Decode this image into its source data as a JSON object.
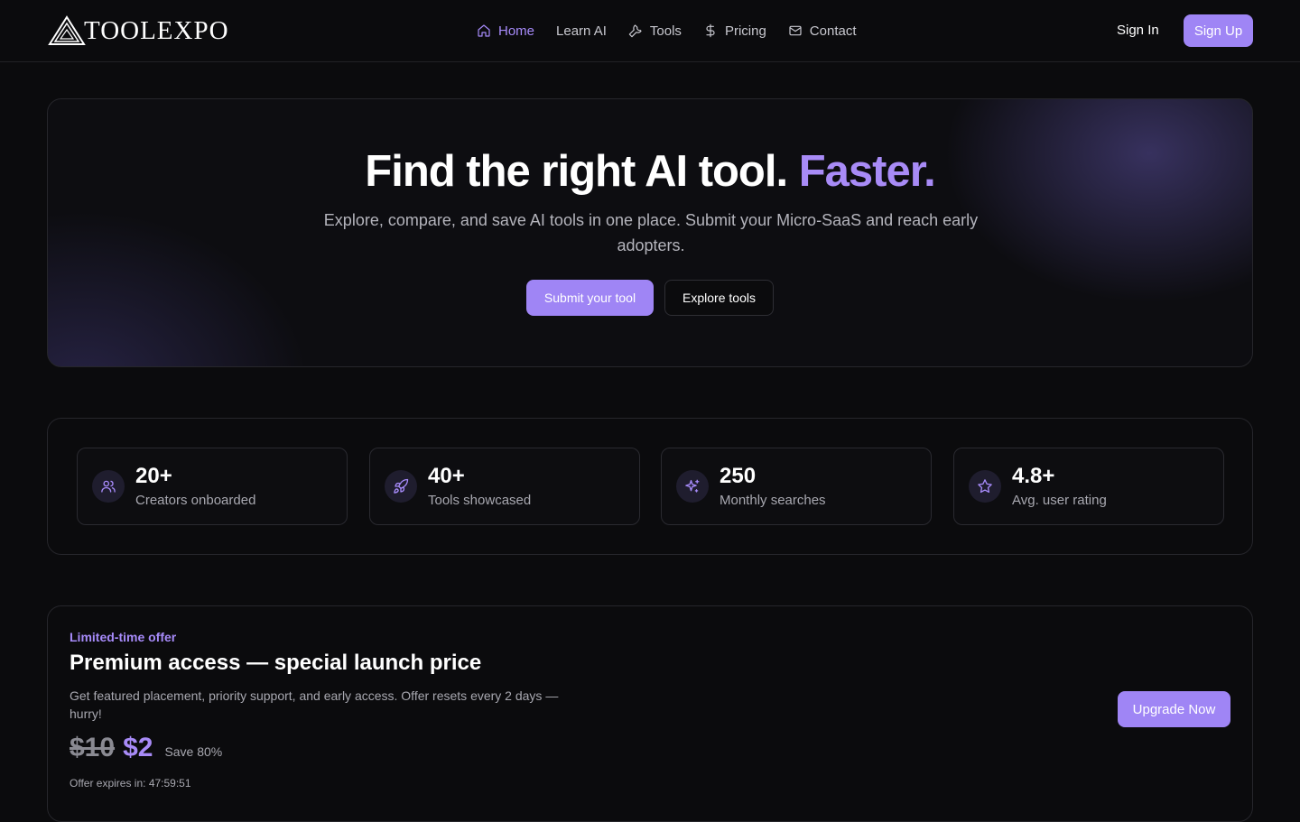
{
  "brand": {
    "name": "TOOLEXPO"
  },
  "nav": {
    "items": [
      {
        "label": "Home",
        "icon": "home-icon",
        "active": true
      },
      {
        "label": "Learn AI",
        "icon": "",
        "active": false
      },
      {
        "label": "Tools",
        "icon": "wrench-icon",
        "active": false
      },
      {
        "label": "Pricing",
        "icon": "dollar-icon",
        "active": false
      },
      {
        "label": "Contact",
        "icon": "mail-icon",
        "active": false
      }
    ],
    "sign_in": "Sign In",
    "sign_up": "Sign Up"
  },
  "hero": {
    "title_main": "Find the right AI tool.",
    "title_accent": "Faster.",
    "subtitle": "Explore, compare, and save AI tools in one place. Submit your Micro-SaaS and reach early adopters.",
    "primary_button": "Submit your tool",
    "secondary_button": "Explore tools"
  },
  "stats": [
    {
      "value": "20+",
      "label": "Creators onboarded",
      "icon": "users-icon"
    },
    {
      "value": "40+",
      "label": "Tools showcased",
      "icon": "rocket-icon"
    },
    {
      "value": "250",
      "label": "Monthly searches",
      "icon": "sparkles-icon"
    },
    {
      "value": "4.8+",
      "label": "Avg. user rating",
      "icon": "star-icon"
    }
  ],
  "offer": {
    "tag": "Limited-time offer",
    "title": "Premium access — special launch price",
    "description": "Get featured placement, priority support, and early access. Offer resets every 2 days — hurry!",
    "old_price": "$10",
    "new_price": "$2",
    "save_text": "Save 80%",
    "expires": "Offer expires in: 47:59:51",
    "button": "Upgrade Now"
  },
  "colors": {
    "accent": "#a78bfa",
    "button": "#9f85f5",
    "background": "#0b0b0d"
  }
}
